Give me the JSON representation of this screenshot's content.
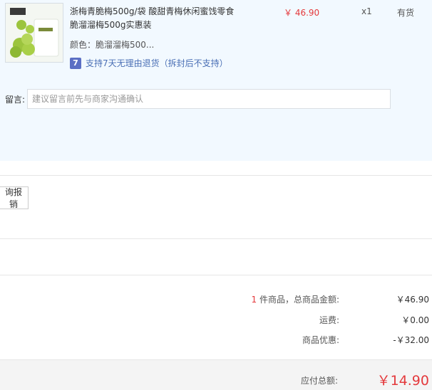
{
  "item": {
    "title": "浙梅青脆梅500g/袋 酸甜青梅休闲蜜饯零食脆溜溜梅500g实惠装",
    "spec_label": "颜色：",
    "spec_value": "脆溜溜梅500...",
    "refund_badge": "7",
    "refund_text": "支持7天无理由退货（拆封后不支持）",
    "price": "￥ 46.90",
    "qty": "x1",
    "stock": "有货"
  },
  "message": {
    "label": "留言:",
    "placeholder": "建议留言前先与商家沟通确认"
  },
  "invoice": {
    "label": "询报销"
  },
  "summary": {
    "count": "1",
    "count_label": "件商品，总商品金额:",
    "goods_total": "￥46.90",
    "shipping_label": "运费:",
    "shipping": "￥0.00",
    "discount_label": "商品优惠:",
    "discount": "-￥32.00",
    "payable_label": "应付总额:",
    "payable": "￥14.90"
  },
  "colors": {
    "accent": "#e4393c",
    "panel": "#f2f9ff",
    "link": "#4a6fb5"
  }
}
